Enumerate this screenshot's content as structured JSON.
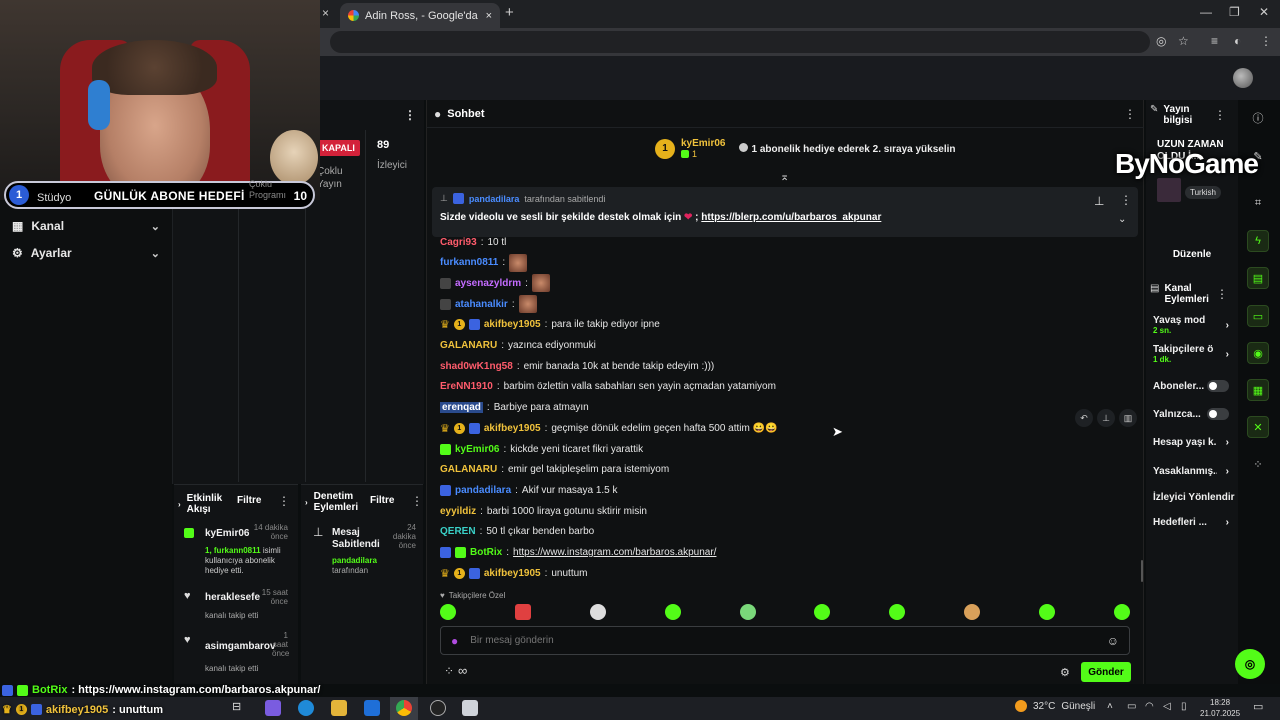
{
  "browser": {
    "tab_title": "Adin Ross, - Google'da Ara",
    "close_glyph": "×",
    "new_tab_glyph": "+",
    "window_controls": [
      "—",
      "❐",
      "✕"
    ]
  },
  "overlay": {
    "goal_number": "1",
    "goal_behind": "Stüdyo",
    "goal_title": "GÜNLÜK ABONE HEDEFİ",
    "goal_count": "10",
    "goal_behind_right": "Çoklu Programı"
  },
  "sidebar": {
    "items": [
      {
        "label": "Kanal",
        "icon": "broadcast-icon"
      },
      {
        "label": "Ayarlar",
        "icon": "gear-icon"
      }
    ]
  },
  "dashboard": {
    "status_badge": "KAPALI",
    "multistream": "Çoklu Yayın",
    "viewers_count": "89",
    "viewers_label": "İzleyici"
  },
  "activity_feed": {
    "title": "Etkinlik Akışı",
    "filter_label": "Filtre",
    "items": [
      {
        "name": "kyEmir06",
        "time": "14 dakika önce",
        "detail_highlight": "1, furkann0811",
        "detail": "isimli kullanıcıya abonelik hediye etti."
      },
      {
        "name": "heraklesefe",
        "time": "15 saat önce",
        "detail": "kanalı takip etti"
      },
      {
        "name": "asimgambarov",
        "time": "1 saat önce",
        "detail": "kanalı takip etti"
      }
    ]
  },
  "mod_actions": {
    "title": "Denetim Eylemleri",
    "filter_label": "Filtre",
    "items": [
      {
        "title": "Mesaj Sabitlendi",
        "time": "24 dakika önce",
        "by_user": "pandadilara",
        "by_suffix": "tarafından"
      }
    ]
  },
  "chat": {
    "title": "Sohbet",
    "gift_leader": {
      "user": "kyEmir06",
      "count": "1",
      "cta": "1 abonelik hediye ederek 2. sıraya yükselin"
    },
    "pinned": {
      "by_user": "pandadilara",
      "by_suffix": "tarafından sabitlendi",
      "text": "Sizde videolu ve sesli bir şekilde destek olmak için",
      "heart": "❤",
      "separator": ";",
      "link": "https://blerp.com/u/barbaros_akpunar"
    },
    "messages": [
      {
        "user": "Cagri93",
        "color": "#ff5c6c",
        "text": "10 tl",
        "badges": []
      },
      {
        "user": "furkann0811",
        "color": "#4a8cff",
        "text": "",
        "emote": true,
        "badges": []
      },
      {
        "user": "aysenazyldrm",
        "color": "#c46cff",
        "text": "",
        "emote": true,
        "badges": [
          "gray"
        ]
      },
      {
        "user": "atahanalkir",
        "color": "#4a8cff",
        "text": "",
        "emote": true,
        "badges": [
          "gray"
        ]
      },
      {
        "user": "akifbey1905",
        "color": "#f0c23c",
        "text": "para ile takip ediyor ipne",
        "badges": [
          "crown",
          "gold",
          "blue"
        ]
      },
      {
        "user": "GALANARU",
        "color": "#f0c23c",
        "text": "yazınca ediyonmuki",
        "badges": []
      },
      {
        "user": "shad0wK1ng58",
        "color": "#ff5c6c",
        "text": "emir banada 10k at bende takip edeyim :)))",
        "badges": []
      },
      {
        "user": "EreNN1910",
        "color": "#ff5c6c",
        "text": "barbim özlettin valla sabahları sen yayin açmadan yatamiyom",
        "badges": []
      },
      {
        "user": "erenqad",
        "color": "#ffffff",
        "text": "Barbiye para atmayın",
        "badges": []
      },
      {
        "user": "akifbey1905",
        "color": "#f0c23c",
        "text": "geçmişe dönük edelim geçen hafta 500 attim 😀😀",
        "badges": [
          "crown",
          "gold",
          "blue"
        ]
      },
      {
        "user": "kyEmir06",
        "color": "#53fc18",
        "text": "kickde yeni ticaret fikri yarattik",
        "badges": [
          "green"
        ]
      },
      {
        "user": "GALANARU",
        "color": "#f0c23c",
        "text": "emir gel takipleşelim para istemiyom",
        "badges": []
      },
      {
        "user": "pandadilara",
        "color": "#4a8cff",
        "text": "Akif vur masaya 1.5 k",
        "badges": [
          "blue"
        ]
      },
      {
        "user": "eyyildiz",
        "color": "#f0c23c",
        "text": "barbi 1000 liraya gotunu sktirir misin",
        "badges": []
      },
      {
        "user": "QEREN",
        "color": "#3ad1c8",
        "text": "50 tl çıkar benden barbo",
        "badges": []
      },
      {
        "user": "BotRix",
        "color": "#53fc18",
        "text": "https://www.instagram.com/barbaros.akpunar/",
        "badges": [
          "blue",
          "green"
        ]
      },
      {
        "user": "akifbey1905",
        "color": "#f0c23c",
        "text": "unuttum",
        "badges": [
          "crown",
          "gold",
          "blue"
        ]
      }
    ],
    "followers_only_label": "Takipçilere Özel",
    "input_placeholder": "Bir mesaj gönderin",
    "send_label": "Gönder",
    "points_symbol": "∞"
  },
  "stream_info": {
    "title": "Yayın bilgisi",
    "stream_title": "UZUN ZAMAN OLDU İ...",
    "language": "Turkish",
    "edit_label": "Düzenle"
  },
  "channel_actions": {
    "title": "Kanal Eylemleri",
    "items": [
      {
        "label": "Yavaş mod",
        "sub": "2 sn."
      },
      {
        "label": "Takipçilere ö...",
        "sub": "1 dk."
      },
      {
        "label": "Aboneler...",
        "toggle": true
      },
      {
        "label": "Yalnızca...",
        "toggle": true
      },
      {
        "label": "Hesap yaşı k..."
      },
      {
        "label": "Yasaklanmış..."
      },
      {
        "label": "İzleyici Yönlendir"
      },
      {
        "label": "Hedefleri ..."
      }
    ]
  },
  "watermark": "ByNoGame",
  "bottom_overlay": [
    {
      "user": "BotRix",
      "text": ": https://www.instagram.com/barbaros.akpunar/"
    },
    {
      "user": "akifbey1905",
      "text": ": unuttum"
    }
  ],
  "taskbar": {
    "temperature": "32°C",
    "weather": "Güneşli",
    "time": "18:28",
    "date": "21.07.2025"
  },
  "colors": {
    "brand": "#53fc18",
    "accent_gold": "#e5b11b",
    "live_off": "#d3223a"
  }
}
